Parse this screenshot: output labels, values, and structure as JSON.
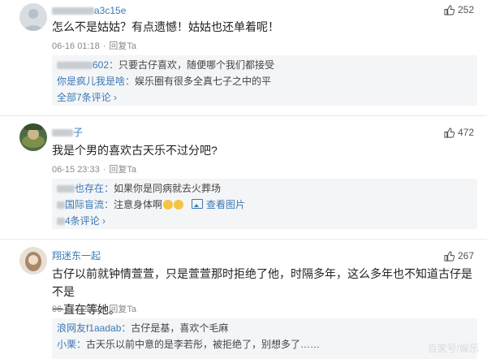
{
  "comments": [
    {
      "username": "a3c15e",
      "likes": "252",
      "text": "怎么不是姑姑？有点遗憾！姑姑也还单着呢！",
      "date": "06-16 01:18",
      "reply_label": "回复Ta",
      "replies": [
        {
          "user": "602：",
          "text": "只要古仔喜欢，随便哪个我们都接受"
        },
        {
          "user": "你是疯儿我是啥：",
          "text": "娱乐圈有很多全真七子之中的平"
        }
      ],
      "more": "全部7条评论 ›"
    },
    {
      "username": "子",
      "likes": "472",
      "text": "我是个男的喜欢古天乐不过分吧?",
      "date": "06-15 23:33",
      "reply_label": "回复Ta",
      "replies": [
        {
          "user": "也存在：",
          "text": "如果你是同病就去火葬场"
        },
        {
          "user": "国际盲流：",
          "text": "注意身体啊",
          "pic_label": "查看图片"
        }
      ],
      "more": "4条评论 ›"
    },
    {
      "username": "翔迷东一起",
      "likes": "267",
      "text_line1": "古仔以前就钟情萱萱，只是萱萱那时拒绝了他，时隔多年，这么多年也不知道古仔是不是",
      "text_line2": "一直在等她。",
      "date": "06-16 02:42",
      "reply_label": "回复Ta",
      "replies": [
        {
          "user": "浪网友f1aadab：",
          "text": "古仔是基，喜欢个毛麻"
        },
        {
          "user": "小栗：",
          "text": "古天乐以前中意的是李若彤，被拒绝了，别想多了……"
        }
      ]
    }
  ],
  "watermark": "百家号/娱乐"
}
